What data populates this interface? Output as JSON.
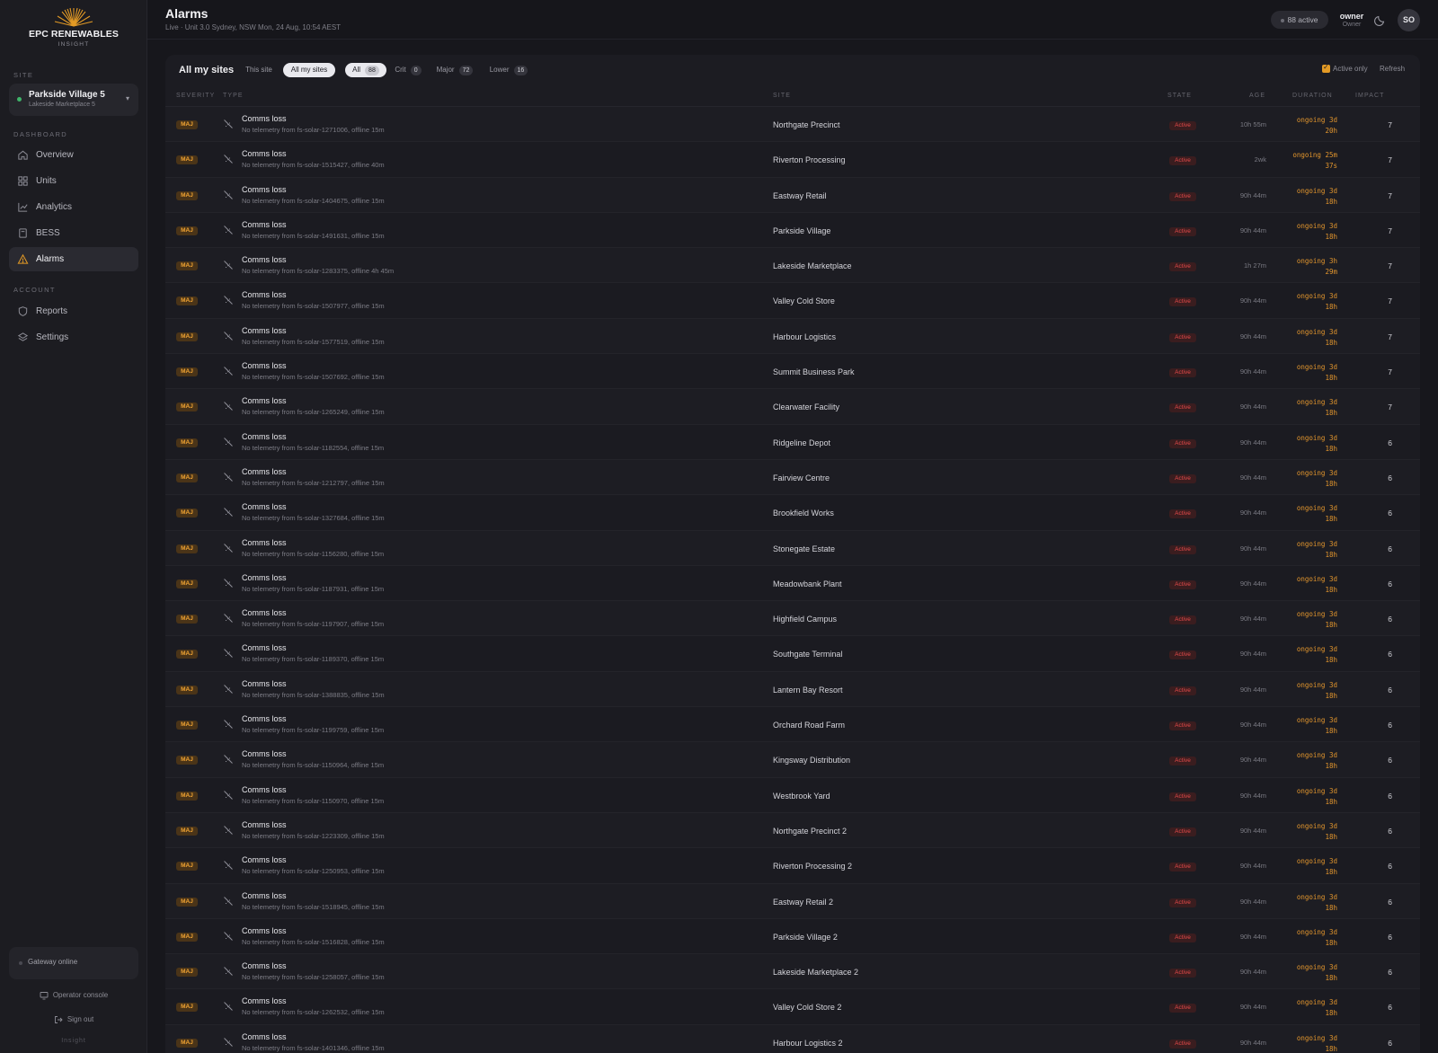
{
  "brand": {
    "name": "EPC RENEWABLES",
    "sub": "INSIGHT"
  },
  "sidebar": {
    "site_section": "SITE",
    "site_selector": {
      "name": "Parkside Village 5",
      "sub": "Lakeside Marketplace 5",
      "chevron": "chevron-down-icon"
    },
    "dashboard_section": "DASHBOARD",
    "nav": [
      {
        "label": "Overview",
        "icon": "home-icon",
        "active": false
      },
      {
        "label": "Units",
        "icon": "grid-icon",
        "active": false
      },
      {
        "label": "Analytics",
        "icon": "chart-icon",
        "active": false
      },
      {
        "label": "BESS",
        "icon": "battery-icon",
        "active": false
      },
      {
        "label": "Alarms",
        "icon": "warning-icon",
        "active": true
      }
    ],
    "account_section": "ACCOUNT",
    "account_nav": [
      {
        "label": "Reports",
        "icon": "shield-icon"
      },
      {
        "label": "Settings",
        "icon": "settings-icon"
      }
    ],
    "gateway": "Gateway online",
    "operator_console": "Operator console",
    "sign_out": "Sign out",
    "footer": "Insight"
  },
  "header": {
    "title": "Alarms",
    "subtitle": "Live · Unit 3.0 Sydney, NSW Mon, 24 Aug, 10:54 AEST",
    "active_count": "88 active",
    "user_name": "owner",
    "user_role": "Owner",
    "avatar": "SO"
  },
  "toolbar": {
    "title": "All my sites",
    "scope": [
      "This site",
      "All my sites"
    ],
    "scope_selected": "All my sites",
    "filters": [
      {
        "label": "All",
        "count": "88",
        "on": true
      },
      {
        "label": "Crit",
        "count": "0",
        "on": false
      },
      {
        "label": "Major",
        "count": "72",
        "on": false
      },
      {
        "label": "Lower",
        "count": "16",
        "on": false
      }
    ],
    "active_only": "Active only",
    "active_only_checked": true,
    "refresh": "Refresh"
  },
  "columns": [
    "SEVERITY",
    "TYPE",
    "SITE",
    "STATE",
    "AGE",
    "DURATION",
    "IMPACT"
  ],
  "rows": [
    {
      "sev": "MAJ",
      "title": "Comms loss",
      "desc": "No telemetry from fs-solar-1271006, offline 15m",
      "site": "Northgate Precinct",
      "state": "Active",
      "age": "10h 55m",
      "dur1": "ongoing 3d",
      "dur2": "20h",
      "impact": "7"
    },
    {
      "sev": "MAJ",
      "title": "Comms loss",
      "desc": "No telemetry from fs-solar-1515427, offline 40m",
      "site": "Riverton Processing",
      "state": "Active",
      "age": "2wk",
      "dur1": "ongoing 25m",
      "dur2": "37s",
      "impact": "7"
    },
    {
      "sev": "MAJ",
      "title": "Comms loss",
      "desc": "No telemetry from fs-solar-1404675, offline 15m",
      "site": "Eastway Retail",
      "state": "Active",
      "age": "90h 44m",
      "dur1": "ongoing 3d",
      "dur2": "18h",
      "impact": "7"
    },
    {
      "sev": "MAJ",
      "title": "Comms loss",
      "desc": "No telemetry from fs-solar-1491631, offline 15m",
      "site": "Parkside Village",
      "state": "Active",
      "age": "90h 44m",
      "dur1": "ongoing 3d",
      "dur2": "18h",
      "impact": "7"
    },
    {
      "sev": "MAJ",
      "title": "Comms loss",
      "desc": "No telemetry from fs-solar-1283375, offline 4h 45m",
      "site": "Lakeside Marketplace",
      "state": "Active",
      "age": "1h 27m",
      "dur1": "ongoing 3h",
      "dur2": "29m",
      "impact": "7"
    },
    {
      "sev": "MAJ",
      "title": "Comms loss",
      "desc": "No telemetry from fs-solar-1507977, offline 15m",
      "site": "Valley Cold Store",
      "state": "Active",
      "age": "90h 44m",
      "dur1": "ongoing 3d",
      "dur2": "18h",
      "impact": "7"
    },
    {
      "sev": "MAJ",
      "title": "Comms loss",
      "desc": "No telemetry from fs-solar-1577519, offline 15m",
      "site": "Harbour Logistics",
      "state": "Active",
      "age": "90h 44m",
      "dur1": "ongoing 3d",
      "dur2": "18h",
      "impact": "7"
    },
    {
      "sev": "MAJ",
      "title": "Comms loss",
      "desc": "No telemetry from fs-solar-1507692, offline 15m",
      "site": "Summit Business Park",
      "state": "Active",
      "age": "90h 44m",
      "dur1": "ongoing 3d",
      "dur2": "18h",
      "impact": "7"
    },
    {
      "sev": "MAJ",
      "title": "Comms loss",
      "desc": "No telemetry from fs-solar-1265249, offline 15m",
      "site": "Clearwater Facility",
      "state": "Active",
      "age": "90h 44m",
      "dur1": "ongoing 3d",
      "dur2": "18h",
      "impact": "7"
    },
    {
      "sev": "MAJ",
      "title": "Comms loss",
      "desc": "No telemetry from fs-solar-1182554, offline 15m",
      "site": "Ridgeline Depot",
      "state": "Active",
      "age": "90h 44m",
      "dur1": "ongoing 3d",
      "dur2": "18h",
      "impact": "6"
    },
    {
      "sev": "MAJ",
      "title": "Comms loss",
      "desc": "No telemetry from fs-solar-1212797, offline 15m",
      "site": "Fairview Centre",
      "state": "Active",
      "age": "90h 44m",
      "dur1": "ongoing 3d",
      "dur2": "18h",
      "impact": "6"
    },
    {
      "sev": "MAJ",
      "title": "Comms loss",
      "desc": "No telemetry from fs-solar-1327684, offline 15m",
      "site": "Brookfield Works",
      "state": "Active",
      "age": "90h 44m",
      "dur1": "ongoing 3d",
      "dur2": "18h",
      "impact": "6"
    },
    {
      "sev": "MAJ",
      "title": "Comms loss",
      "desc": "No telemetry from fs-solar-1156280, offline 15m",
      "site": "Stonegate Estate",
      "state": "Active",
      "age": "90h 44m",
      "dur1": "ongoing 3d",
      "dur2": "18h",
      "impact": "6"
    },
    {
      "sev": "MAJ",
      "title": "Comms loss",
      "desc": "No telemetry from fs-solar-1187931, offline 15m",
      "site": "Meadowbank Plant",
      "state": "Active",
      "age": "90h 44m",
      "dur1": "ongoing 3d",
      "dur2": "18h",
      "impact": "6"
    },
    {
      "sev": "MAJ",
      "title": "Comms loss",
      "desc": "No telemetry from fs-solar-1197907, offline 15m",
      "site": "Highfield Campus",
      "state": "Active",
      "age": "90h 44m",
      "dur1": "ongoing 3d",
      "dur2": "18h",
      "impact": "6"
    },
    {
      "sev": "MAJ",
      "title": "Comms loss",
      "desc": "No telemetry from fs-solar-1189370, offline 15m",
      "site": "Southgate Terminal",
      "state": "Active",
      "age": "90h 44m",
      "dur1": "ongoing 3d",
      "dur2": "18h",
      "impact": "6"
    },
    {
      "sev": "MAJ",
      "title": "Comms loss",
      "desc": "No telemetry from fs-solar-1388835, offline 15m",
      "site": "Lantern Bay Resort",
      "state": "Active",
      "age": "90h 44m",
      "dur1": "ongoing 3d",
      "dur2": "18h",
      "impact": "6"
    },
    {
      "sev": "MAJ",
      "title": "Comms loss",
      "desc": "No telemetry from fs-solar-1199759, offline 15m",
      "site": "Orchard Road Farm",
      "state": "Active",
      "age": "90h 44m",
      "dur1": "ongoing 3d",
      "dur2": "18h",
      "impact": "6"
    },
    {
      "sev": "MAJ",
      "title": "Comms loss",
      "desc": "No telemetry from fs-solar-1150964, offline 15m",
      "site": "Kingsway Distribution",
      "state": "Active",
      "age": "90h 44m",
      "dur1": "ongoing 3d",
      "dur2": "18h",
      "impact": "6"
    },
    {
      "sev": "MAJ",
      "title": "Comms loss",
      "desc": "No telemetry from fs-solar-1150970, offline 15m",
      "site": "Westbrook Yard",
      "state": "Active",
      "age": "90h 44m",
      "dur1": "ongoing 3d",
      "dur2": "18h",
      "impact": "6"
    },
    {
      "sev": "MAJ",
      "title": "Comms loss",
      "desc": "No telemetry from fs-solar-1223309, offline 15m",
      "site": "Northgate Precinct 2",
      "state": "Active",
      "age": "90h 44m",
      "dur1": "ongoing 3d",
      "dur2": "18h",
      "impact": "6"
    },
    {
      "sev": "MAJ",
      "title": "Comms loss",
      "desc": "No telemetry from fs-solar-1250953, offline 15m",
      "site": "Riverton Processing 2",
      "state": "Active",
      "age": "90h 44m",
      "dur1": "ongoing 3d",
      "dur2": "18h",
      "impact": "6"
    },
    {
      "sev": "MAJ",
      "title": "Comms loss",
      "desc": "No telemetry from fs-solar-1518945, offline 15m",
      "site": "Eastway Retail 2",
      "state": "Active",
      "age": "90h 44m",
      "dur1": "ongoing 3d",
      "dur2": "18h",
      "impact": "6"
    },
    {
      "sev": "MAJ",
      "title": "Comms loss",
      "desc": "No telemetry from fs-solar-1516828, offline 15m",
      "site": "Parkside Village 2",
      "state": "Active",
      "age": "90h 44m",
      "dur1": "ongoing 3d",
      "dur2": "18h",
      "impact": "6"
    },
    {
      "sev": "MAJ",
      "title": "Comms loss",
      "desc": "No telemetry from fs-solar-1258057, offline 15m",
      "site": "Lakeside Marketplace 2",
      "state": "Active",
      "age": "90h 44m",
      "dur1": "ongoing 3d",
      "dur2": "18h",
      "impact": "6"
    },
    {
      "sev": "MAJ",
      "title": "Comms loss",
      "desc": "No telemetry from fs-solar-1262532, offline 15m",
      "site": "Valley Cold Store 2",
      "state": "Active",
      "age": "90h 44m",
      "dur1": "ongoing 3d",
      "dur2": "18h",
      "impact": "6"
    },
    {
      "sev": "MAJ",
      "title": "Comms loss",
      "desc": "No telemetry from fs-solar-1401346, offline 15m",
      "site": "Harbour Logistics 2",
      "state": "Active",
      "age": "90h 44m",
      "dur1": "ongoing 3d",
      "dur2": "18h",
      "impact": "6"
    }
  ],
  "colors": {
    "accent": "#e39a25",
    "major_badge_bg": "#4a3418",
    "active_red": "#e54a4a",
    "online_green": "#3fb56a"
  }
}
